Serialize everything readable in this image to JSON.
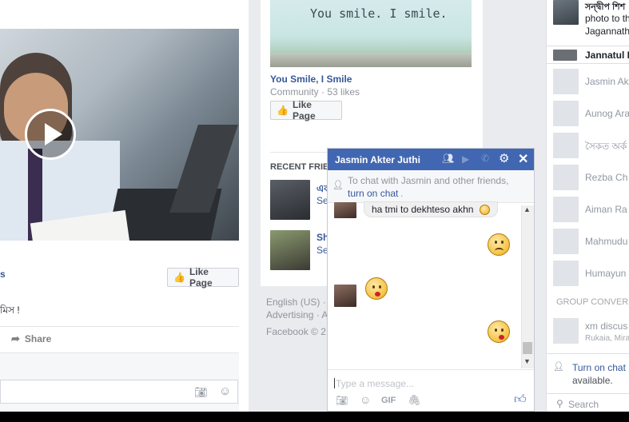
{
  "left_post": {
    "link_fragment": "s",
    "bengali_text": "মিস !",
    "like_page_label": "Like Page",
    "share_label": "Share"
  },
  "middle": {
    "banner_text": "You smile. I smile.",
    "page_title": "You Smile, I Smile",
    "page_meta": "Community · 53 likes",
    "like_page_label": "Like Page",
    "recent_friends_header": "RECENT FRIEN",
    "friend1_name": "এক",
    "friend1_sub": "Se",
    "friend2_name": "Sh",
    "friend2_sub": "Se",
    "footer_line1": "English (US) ·",
    "footer_line2": "Advertising · A",
    "footer_line3": "Facebook © 2"
  },
  "chat": {
    "title": "Jasmin Akter Juthi",
    "notice": "To chat with Jasmin and other friends,",
    "notice_link": "turn on chat",
    "notice_end": ".",
    "message_in": "ha tmi to dekhteso akhn",
    "input_placeholder": "Type a message...",
    "gif_label": "GIF"
  },
  "sidebar": {
    "top_name": "সন্দ্বীপ শিশ",
    "top_line2": "photo to th",
    "top_line3": "Jagannath",
    "featured_name": "Jannatul F",
    "contacts": [
      "Jasmin Ak",
      "Aunog Ara",
      "সৈকত অর্ক",
      "Rezba Ch",
      "Aiman Ra",
      "Mahmudu",
      "Humayun"
    ],
    "group_header": "GROUP CONVERS",
    "group_name": "xm discus",
    "group_members": "Rukaia, Mira",
    "turn_on_chat": "Turn on chat",
    "available": "available.",
    "search_placeholder": "Search"
  }
}
